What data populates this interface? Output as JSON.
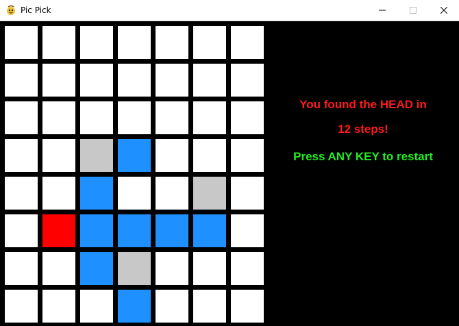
{
  "window": {
    "title": "Pic Pick"
  },
  "board": {
    "rows": 8,
    "cols": 7,
    "colors": {
      "empty": "#ffffff",
      "body": "#1e90ff",
      "miss": "#c8c8c8",
      "head": "#ff0000"
    },
    "cells": [
      [
        "empty",
        "empty",
        "empty",
        "empty",
        "empty",
        "empty",
        "empty"
      ],
      [
        "empty",
        "empty",
        "empty",
        "empty",
        "empty",
        "empty",
        "empty"
      ],
      [
        "empty",
        "empty",
        "empty",
        "empty",
        "empty",
        "empty",
        "empty"
      ],
      [
        "empty",
        "empty",
        "miss",
        "body",
        "empty",
        "empty",
        "empty"
      ],
      [
        "empty",
        "empty",
        "body",
        "empty",
        "empty",
        "miss",
        "empty"
      ],
      [
        "empty",
        "head",
        "body",
        "body",
        "body",
        "body",
        "empty"
      ],
      [
        "empty",
        "empty",
        "body",
        "miss",
        "empty",
        "empty",
        "empty"
      ],
      [
        "empty",
        "empty",
        "empty",
        "body",
        "empty",
        "empty",
        "empty"
      ]
    ]
  },
  "message": {
    "line1": "You found the HEAD in",
    "line2": "12 steps!",
    "line3": "Press ANY KEY to restart",
    "color_result": "#ff1a1a",
    "color_restart": "#22ee22"
  }
}
